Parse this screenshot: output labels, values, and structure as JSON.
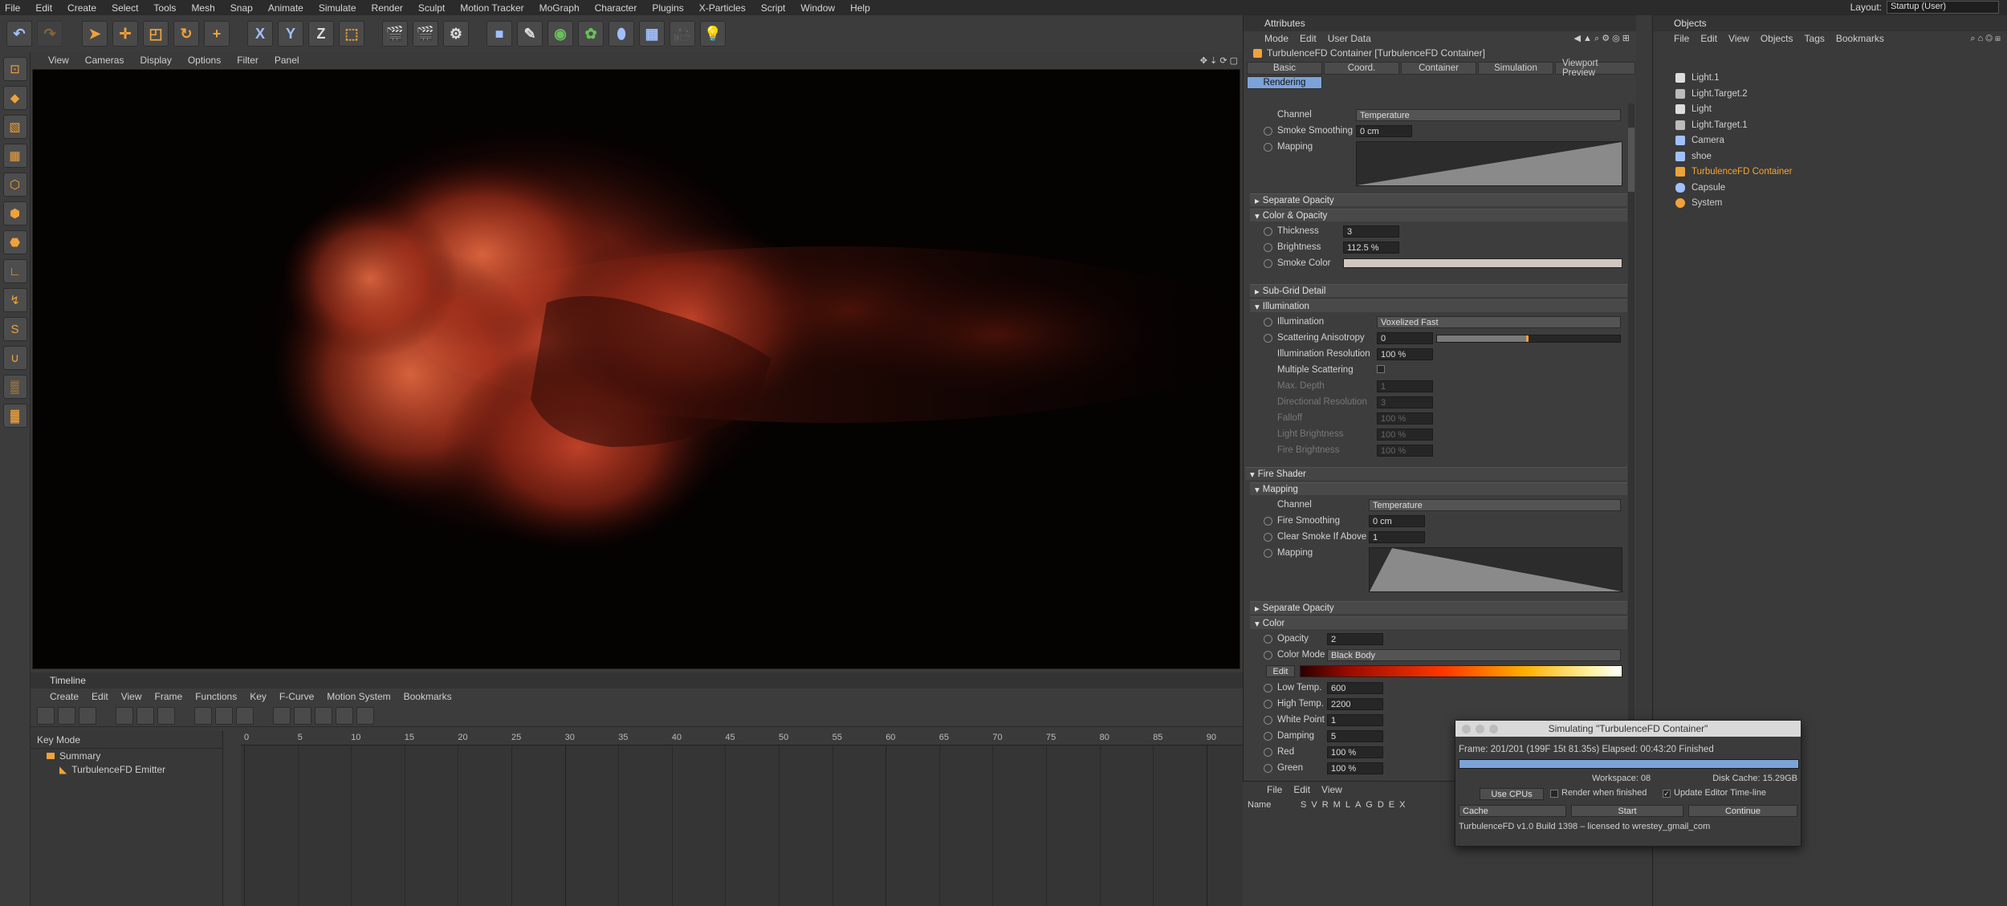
{
  "menubar": {
    "items": [
      "File",
      "Edit",
      "Create",
      "Select",
      "Tools",
      "Mesh",
      "Snap",
      "Animate",
      "Simulate",
      "Render",
      "Sculpt",
      "Motion Tracker",
      "MoGraph",
      "Character",
      "Plugins",
      "X-Particles",
      "Script",
      "Window",
      "Help"
    ],
    "layout_label": "Layout:",
    "layout_value": "Startup (User)"
  },
  "toolbar": {
    "axis_x": "X",
    "axis_y": "Y",
    "axis_z": "Z"
  },
  "viewport": {
    "menu": [
      "View",
      "Cameras",
      "Display",
      "Options",
      "Filter",
      "Panel"
    ]
  },
  "timeline": {
    "title": "Timeline",
    "menu": [
      "Create",
      "Edit",
      "View",
      "Frame",
      "Functions",
      "Key",
      "F-Curve",
      "Motion System",
      "Bookmarks"
    ],
    "key_mode": "Key Mode",
    "summary": "Summary",
    "emitter": "TurbulenceFD Emitter",
    "ticks": [
      "0",
      "5",
      "10",
      "15",
      "20",
      "25",
      "30",
      "35",
      "40",
      "45",
      "50",
      "55",
      "60",
      "65",
      "70",
      "75",
      "80",
      "85",
      "90"
    ]
  },
  "attributes": {
    "title": "Attributes",
    "menu": [
      "Mode",
      "Edit",
      "User Data"
    ],
    "object_title": "TurbulenceFD Container [TurbulenceFD Container]",
    "tabs": [
      "Basic",
      "Coord.",
      "Container",
      "Simulation",
      "Viewport Preview",
      "Rendering"
    ],
    "smoke": {
      "channel_label": "Channel",
      "channel_value": "Temperature",
      "smoothing_label": "Smoke Smoothing",
      "smoothing_value": "0 cm",
      "mapping_label": "Mapping",
      "sep_opacity": "Separate Opacity",
      "color_opacity": "Color & Opacity",
      "thickness_label": "Thickness",
      "thickness_value": "3",
      "brightness_label": "Brightness",
      "brightness_value": "112.5 %",
      "smoke_color_label": "Smoke Color",
      "subgrid": "Sub-Grid Detail",
      "illumination_section": "Illumination",
      "illumination_label": "Illumination",
      "illumination_value": "Voxelized Fast",
      "scattering_label": "Scattering Anisotropy",
      "scattering_value": "0",
      "illum_res_label": "Illumination Resolution",
      "illum_res_value": "100 %",
      "multi_label": "Multiple Scattering",
      "max_depth_label": "Max. Depth",
      "max_depth_value": "1",
      "dir_res_label": "Directional Resolution",
      "dir_res_value": "3",
      "falloff_label": "Falloff",
      "falloff_value": "100 %",
      "light_bright_label": "Light Brightness",
      "light_bright_value": "100 %",
      "fire_bright_label": "Fire Brightness",
      "fire_bright_value": "100 %"
    },
    "fire": {
      "section": "Fire Shader",
      "mapping_section": "Mapping",
      "channel_label": "Channel",
      "channel_value": "Temperature",
      "smoothing_label": "Fire Smoothing",
      "smoothing_value": "0 cm",
      "clear_label": "Clear Smoke If Above",
      "clear_value": "1",
      "mapping_label": "Mapping",
      "sep_opacity": "Separate Opacity",
      "color_section": "Color",
      "opacity_label": "Opacity",
      "opacity_value": "2",
      "color_mode_label": "Color Mode",
      "color_mode_value": "Black Body",
      "edit_label": "Edit",
      "low_label": "Low Temp.",
      "low_value": "600",
      "high_label": "High Temp.",
      "high_value": "2200",
      "white_label": "White Point",
      "white_value": "1",
      "damping_label": "Damping",
      "damping_value": "5",
      "red_label": "Red",
      "red_value": "100 %",
      "green_label": "Green",
      "green_value": "100 %"
    }
  },
  "layers": {
    "menu": [
      "File",
      "Edit",
      "View"
    ],
    "cols": [
      "Name",
      "S",
      "V",
      "R",
      "M",
      "L",
      "A",
      "G",
      "D",
      "E",
      "X"
    ]
  },
  "objects": {
    "title": "Objects",
    "menu": [
      "File",
      "Edit",
      "View",
      "Objects",
      "Tags",
      "Bookmarks"
    ],
    "items": [
      {
        "name": "Light.1"
      },
      {
        "name": "Light.Target.2"
      },
      {
        "name": "Light"
      },
      {
        "name": "Light.Target.1"
      },
      {
        "name": "Camera"
      },
      {
        "name": "shoe"
      },
      {
        "name": "TurbulenceFD Container"
      },
      {
        "name": "Capsule"
      },
      {
        "name": "System"
      }
    ]
  },
  "dialog": {
    "title": "Simulating \"TurbulenceFD Container\"",
    "frame": "Frame: 201/201 (199F 15t 81.35s)  Elapsed: 00:43:20  Finished",
    "progress": 1.0,
    "workspace": "Workspace: 08",
    "disk_cache": "Disk Cache: 15.29GB",
    "use_cpus": "Use  CPUs",
    "render_when": "Render when finished",
    "update_editor": "Update Editor Time-line",
    "cache": "Cache",
    "start": "Start",
    "continue": "Continue",
    "footer": "TurbulenceFD v1.0 Build 1398 – licensed to wrestey_gmail_com"
  },
  "colors": {
    "accent": "#f0a23a",
    "tab_active": "#7ca3d8",
    "highlight_obj": "#f5a430",
    "progress": "#7ca3d8"
  }
}
